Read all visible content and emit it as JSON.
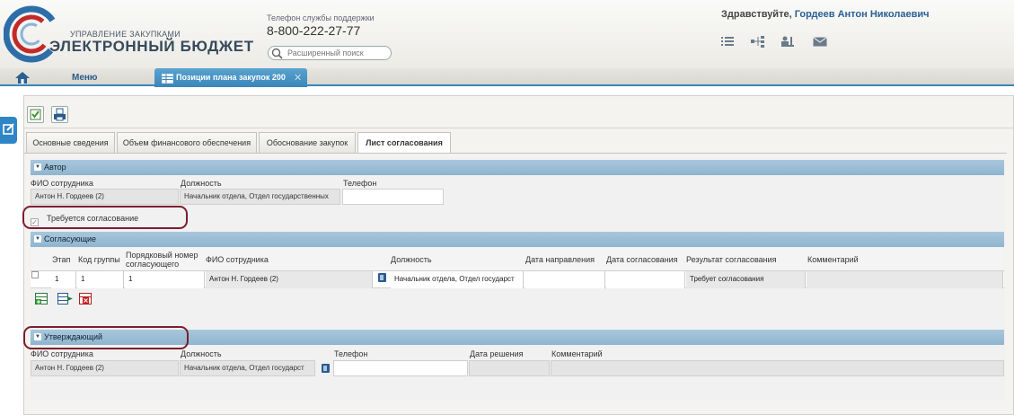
{
  "header": {
    "logo_line1": "УПРАВЛЕНИЕ ЗАКУПКАМИ",
    "logo_line2": "ЭЛЕКТРОННЫЙ БЮДЖЕТ",
    "support_label": "Телефон службы поддержки",
    "support_phone": "8-800-222-27-77",
    "search_placeholder": "Расширенный поиск",
    "greeting": "Здравствуйте,",
    "user_name": "Гордеев Антон Николаевич"
  },
  "nav": {
    "menu_label": "Меню",
    "doc_tab_label": "Позиции плана закупок 200"
  },
  "tabs": [
    {
      "label": "Основные сведения",
      "active": false
    },
    {
      "label": "Объем финансового обеспечения",
      "active": false
    },
    {
      "label": "Обоснование закупок",
      "active": false
    },
    {
      "label": "Лист согласования",
      "active": true
    }
  ],
  "author": {
    "title": "Автор",
    "fio_label": "ФИО сотрудника",
    "position_label": "Должность",
    "phone_label": "Телефон",
    "fio_value": "Антон Н. Гордеев (2)",
    "position_value": "Начальник отдела, Отдел государственных",
    "phone_value": ""
  },
  "approval_required": {
    "label": "Требуется согласование",
    "checked": true
  },
  "approvers": {
    "title": "Согласующие",
    "columns": [
      "Этап",
      "Код группы",
      "Порядковый номер согласующего",
      "ФИО сотрудника",
      "Должность",
      "Дата направления",
      "Дата согласования",
      "Результат согласования",
      "Комментарий"
    ],
    "rows": [
      {
        "stage": "1",
        "group_code": "1",
        "order": "1",
        "fio": "Антон Н. Гордеев (2)",
        "position": "Начальник отдела, Отдел государст",
        "sent_date": "",
        "approved_date": "",
        "result": "Требует согласования",
        "comment": ""
      }
    ]
  },
  "approver_final": {
    "title": "Утверждающий",
    "fio_label": "ФИО сотрудника",
    "position_label": "Должность",
    "phone_label": "Телефон",
    "decision_date_label": "Дата решения",
    "comment_label": "Комментарий",
    "fio_value": "Антон Н. Гордеев (2)",
    "position_value": "Начальник отдела, Отдел государст",
    "phone_value": "",
    "decision_date_value": "",
    "comment_value": ""
  },
  "colors": {
    "accent_blue": "#3a86b9",
    "section_header": "#9dbfd6",
    "highlight_oval": "#7b1e2e"
  }
}
